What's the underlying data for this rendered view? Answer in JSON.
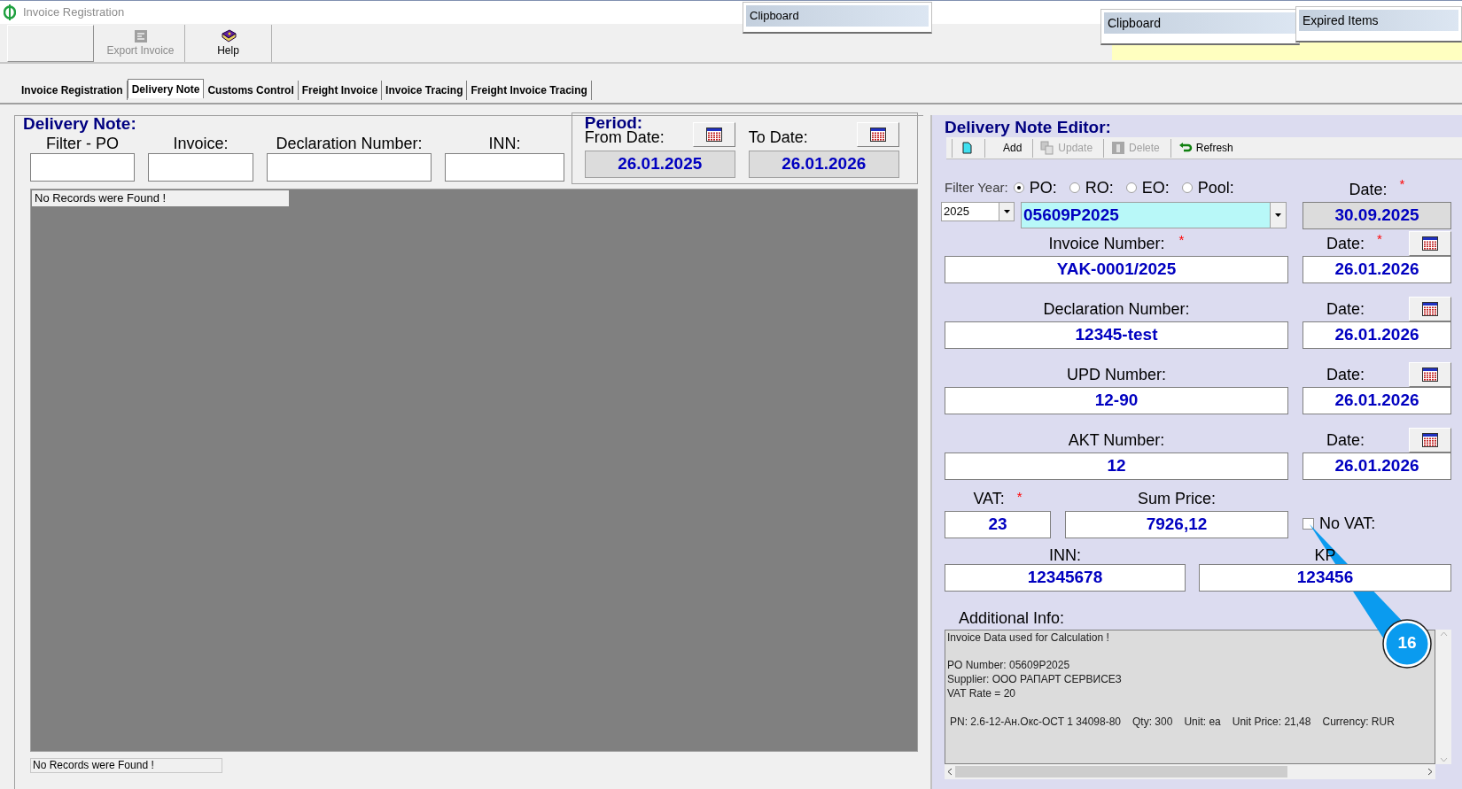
{
  "window": {
    "title": "Invoice Registration"
  },
  "toolbar": {
    "buttons": [
      {
        "kind": "blank"
      },
      {
        "kind": "export",
        "label": "Export Invoice",
        "disabled": true
      },
      {
        "kind": "help",
        "label": "Help",
        "disabled": false
      }
    ]
  },
  "popups": [
    {
      "title": "Clipboard"
    },
    {
      "title": "Clipboard"
    },
    {
      "title": "Expired Items"
    }
  ],
  "tabs": [
    {
      "label": "Invoice Registration",
      "selected": false
    },
    {
      "label": "Delivery Note",
      "selected": true
    },
    {
      "label": "Customs Control",
      "selected": false
    },
    {
      "label": "Freight Invoice",
      "selected": false
    },
    {
      "label": "Invoice Tracing",
      "selected": false
    },
    {
      "label": "Freight Invoice Tracing",
      "selected": false
    }
  ],
  "delivery_note": {
    "title": "Delivery Note:",
    "filters": [
      {
        "label": "Filter - PO"
      },
      {
        "label": "Invoice:"
      },
      {
        "label": "Declaration Number:"
      },
      {
        "label": "INN:"
      }
    ],
    "grid_header": "No Records were Found !",
    "status": "No Records were Found !"
  },
  "period": {
    "title": "Period:",
    "from": {
      "label": "From Date:",
      "value": "26.01.2025"
    },
    "to": {
      "label": "To Date:",
      "value": "26.01.2026"
    }
  },
  "editor": {
    "title": "Delivery Note Editor:",
    "toolbar": [
      {
        "kind": "new",
        "disabled": false
      },
      {
        "kind": "add",
        "label": "Add",
        "disabled": false
      },
      {
        "kind": "update",
        "label": "Update",
        "disabled": true
      },
      {
        "kind": "delete",
        "label": "Delete",
        "disabled": true
      },
      {
        "kind": "refresh",
        "label": "Refresh",
        "disabled": false
      }
    ],
    "filter_year": {
      "label": "Filter Year:",
      "value": "2025"
    },
    "order_types": [
      {
        "label": "PO:",
        "selected": true
      },
      {
        "label": "RO:",
        "selected": false
      },
      {
        "label": "EO:",
        "selected": false
      },
      {
        "label": "Pool:",
        "selected": false
      }
    ],
    "order": {
      "value": "05609P2025"
    },
    "order_date": {
      "label": "Date:",
      "required_mark": "*",
      "value": "30.09.2025"
    },
    "rows": [
      {
        "label": "Invoice Number:",
        "required_mark": "*",
        "value": "YAK-0001/2025",
        "date_label": "Date:",
        "date_required_mark": "*",
        "date": "26.01.2026"
      },
      {
        "label": "Declaration Number:",
        "value": "12345-test",
        "date_label": "Date:",
        "date": "26.01.2026"
      },
      {
        "label": "UPD Number:",
        "value": "12-90",
        "date_label": "Date:",
        "date": "26.01.2026"
      },
      {
        "label": "AKT Number:",
        "value": "12",
        "date_label": "Date:",
        "date": "26.01.2026"
      }
    ],
    "vat": {
      "label": "VAT:",
      "required_mark": "*",
      "value": "23"
    },
    "sum_price": {
      "label": "Sum Price:",
      "value": "7926,12"
    },
    "no_vat": {
      "label": "No VAT:",
      "checked": false
    },
    "inn": {
      "label": "INN:",
      "value": "12345678"
    },
    "kpp": {
      "label": "KP",
      "value": "123456"
    },
    "additional_info": {
      "label": "Additional Info:",
      "lines": [
        "Invoice Data used for Calculation !",
        "PO Number: 05609P2025",
        "Supplier: ООО РАПАРТ СЕРВИСЕЗ",
        "VAT Rate = 20"
      ],
      "item": [
        "PN: 2.6-12-Ан.Окс-ОСТ 1 34098-80",
        "Qty: 300",
        "Unit: ea",
        "Unit Price: 21,48",
        "Currency: RUR"
      ]
    }
  },
  "callout": {
    "label": "16"
  }
}
